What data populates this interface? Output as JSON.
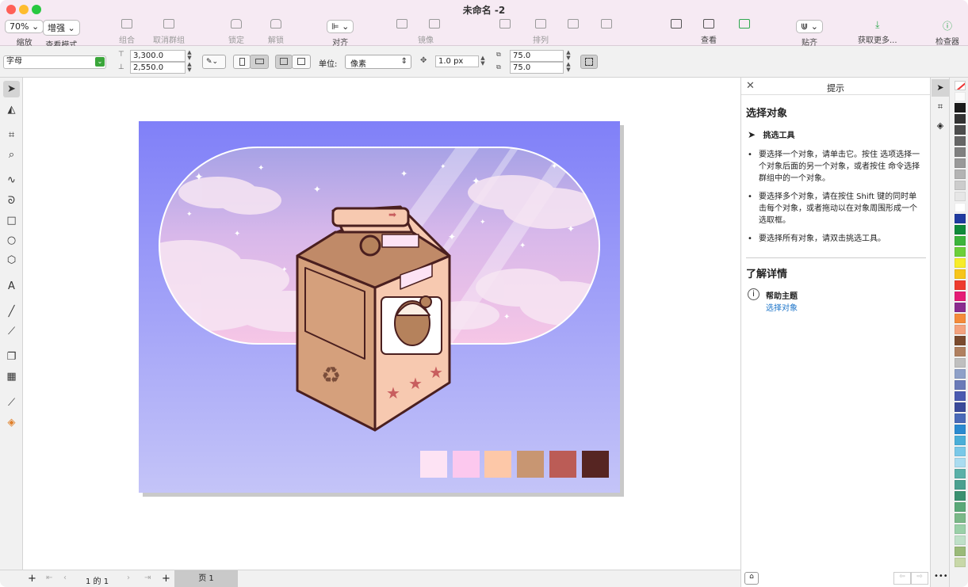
{
  "window": {
    "title": "未命名 -2",
    "traffic": [
      "#ff5f57",
      "#febc2e",
      "#28c840"
    ]
  },
  "toolbar": {
    "zoom_value": "70%",
    "zoom_label": "缩放",
    "view_mode_value": "增强",
    "view_mode_label": "查看模式",
    "group": "组合",
    "ungroup": "取消群组",
    "lock": "锁定",
    "unlock": "解锁",
    "align": "对齐",
    "mirror": "镜像",
    "arrange": "排列",
    "view": "查看",
    "snap": "贴齐",
    "get_more": "获取更多...",
    "inspector": "检查器"
  },
  "propbar": {
    "object_type": "字母",
    "width": "3,300.0",
    "height": "2,550.0",
    "unit_label": "单位:",
    "unit_value": "像素",
    "nudge": "1.0 px",
    "dup_x": "75.0",
    "dup_y": "75.0"
  },
  "tools": [
    "pick-tool",
    "shape-tool",
    "crop-tool",
    "zoom-tool",
    "freehand-tool",
    "artistic-media-tool",
    "rectangle-tool",
    "ellipse-tool",
    "polygon-tool",
    "text-tool",
    "parallel-dimension-tool",
    "connector-tool",
    "drop-shadow-tool",
    "transparency-tool",
    "eyedropper-tool",
    "interactive-fill-tool"
  ],
  "statusbar": {
    "page_info": "1 的 1",
    "page_tab": "页 1"
  },
  "hints": {
    "header": "提示",
    "title": "选择对象",
    "tool_name": "挑选工具",
    "items": [
      "要选择一个对象，请单击它。按住 选项选择一个对象后面的另一个对象，或者按住 命令选择群组中的一个对象。",
      "要选择多个对象，请在按住 Shift 键的同时单击每个对象，或者拖动以在对象周围形成一个选取框。",
      "要选择所有对象，请双击挑选工具。"
    ],
    "learn_more": "了解详情",
    "help_topic": "帮助主题",
    "help_link": "选择对象",
    "link_color": "#1a73c9"
  },
  "artwork": {
    "swatches": [
      "#fde3f4",
      "#fcc8ee",
      "#fdc8a8",
      "#c89672",
      "#bb5c56",
      "#562522"
    ],
    "bg_top": "#8080f8",
    "bg_bottom": "#c4c4f8",
    "box_color": "#d9a583",
    "outline": "#4a1f1f"
  },
  "palette": [
    "#fbfbfb",
    "#1a1a1a",
    "#333333",
    "#4d4d4d",
    "#666666",
    "#808080",
    "#999999",
    "#b3b3b3",
    "#cccccc",
    "#e6e6e6",
    "#ffffff",
    "#1f3aa0",
    "#0f8a3a",
    "#3cb43c",
    "#6ccf3a",
    "#f7ec2a",
    "#f7c51a",
    "#ee3b2e",
    "#e41c76",
    "#8a2c8f",
    "#f58b3a",
    "#f4a27e",
    "#7a4a2e",
    "#b08060",
    "#bfbfbf",
    "#8ea0c8",
    "#6a7ab8",
    "#4a5ab0",
    "#3a4a9a",
    "#4a6ab8",
    "#2a8ad0",
    "#4aaed8",
    "#7ac8e8",
    "#aadcf0",
    "#5ab0a8",
    "#4aa090",
    "#3a9070",
    "#5aa878",
    "#7ab888",
    "#9ad0a8",
    "#bfe0c8",
    "#9aba78",
    "#c8d8a8"
  ]
}
